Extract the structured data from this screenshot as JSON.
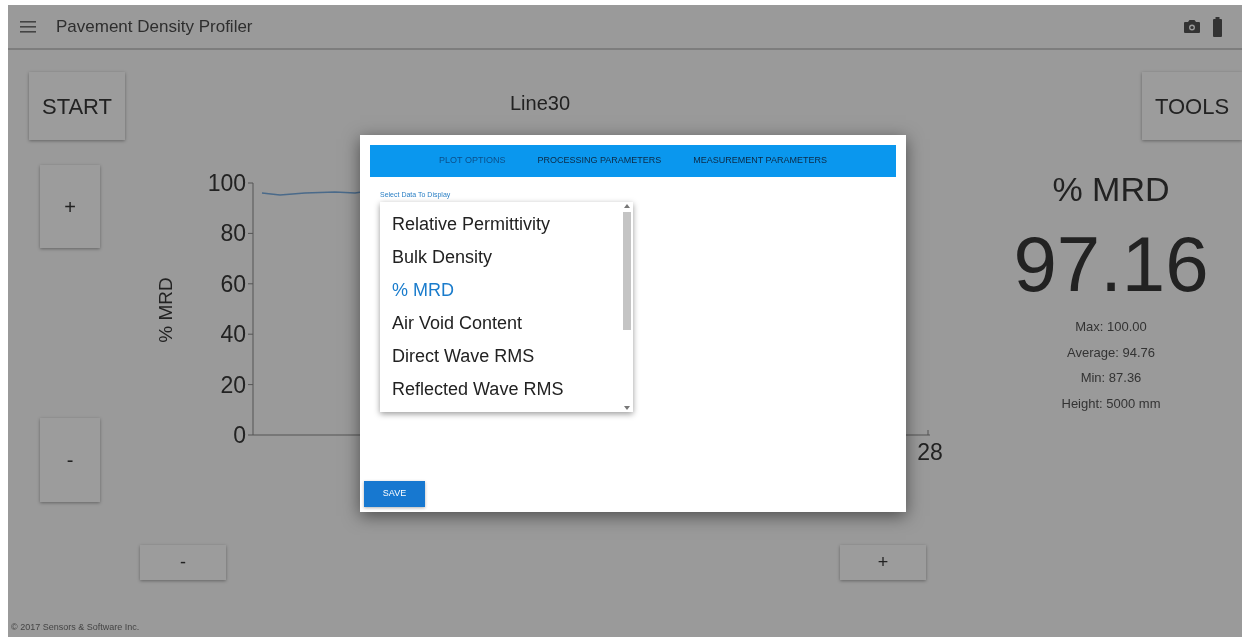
{
  "app_bar": {
    "title": "Pavement Density Profiler"
  },
  "start_button": "START",
  "tools_button": "TOOLS",
  "line_name": "Line30",
  "zoom_buttons": {
    "y_in": "+",
    "y_out": "-",
    "x_out": "-",
    "x_in": "+"
  },
  "chart": {
    "y_label": "% MRD",
    "y_ticks": [
      "100",
      "80",
      "60",
      "40",
      "20",
      "0"
    ],
    "x_ticks": [
      "28"
    ]
  },
  "readout": {
    "label": "% MRD",
    "value": "97.16",
    "stats": [
      "Max: 100.00",
      "Average: 94.76",
      "Min: 87.36",
      "Height: 5000 mm"
    ]
  },
  "footer": "© 2017 Sensors & Software Inc.",
  "dialog": {
    "tabs": [
      {
        "label": "PLOT OPTIONS",
        "selected": true
      },
      {
        "label": "PROCESSING PARAMETERS",
        "selected": false
      },
      {
        "label": "MEASUREMENT PARAMETERS",
        "selected": false
      }
    ],
    "select_label": "Select Data To Display",
    "options": [
      {
        "label": "Relative Permittivity",
        "selected": false
      },
      {
        "label": "Bulk Density",
        "selected": false
      },
      {
        "label": "% MRD",
        "selected": true
      },
      {
        "label": "Air Void Content",
        "selected": false
      },
      {
        "label": "Direct Wave RMS",
        "selected": false
      },
      {
        "label": "Reflected Wave RMS",
        "selected": false
      }
    ],
    "save_button": "SAVE"
  }
}
